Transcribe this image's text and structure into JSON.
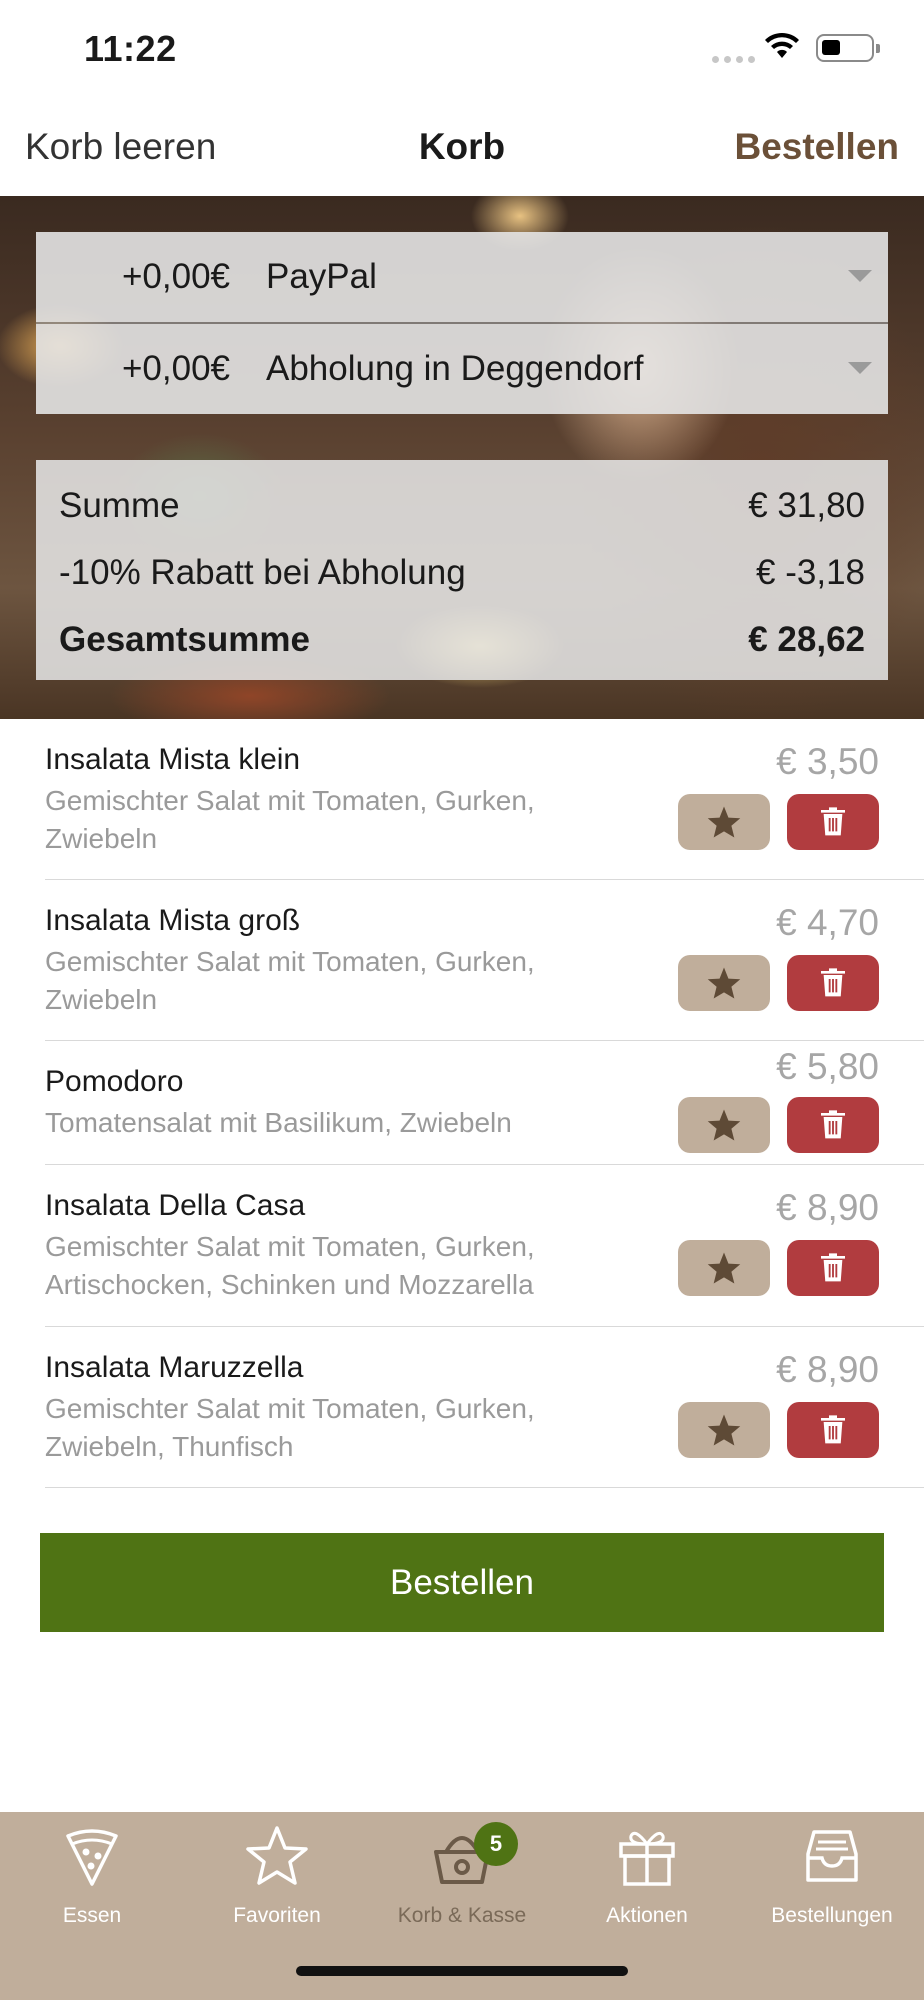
{
  "status": {
    "time": "11:22"
  },
  "nav": {
    "left": "Korb leeren",
    "title": "Korb",
    "right": "Bestellen"
  },
  "payment": {
    "price": "+0,00€",
    "label": "PayPal"
  },
  "delivery": {
    "price": "+0,00€",
    "label": "Abholung in Deggendorf"
  },
  "summary": {
    "subtotal_label": "Summe",
    "subtotal_value": "€ 31,80",
    "discount_label": "-10% Rabatt bei Abholung",
    "discount_value": "€ -3,18",
    "total_label": "Gesamtsumme",
    "total_value": "€ 28,62"
  },
  "items": [
    {
      "name": "Insalata Mista klein",
      "desc": "Gemischter Salat mit Tomaten, Gurken, Zwiebeln",
      "price": "€ 3,50"
    },
    {
      "name": "Insalata Mista groß",
      "desc": "Gemischter Salat mit Tomaten, Gurken, Zwiebeln",
      "price": "€ 4,70"
    },
    {
      "name": "Pomodoro",
      "desc": "Tomatensalat mit Basilikum, Zwiebeln",
      "price": "€ 5,80"
    },
    {
      "name": "Insalata Della Casa",
      "desc": "Gemischter Salat mit Tomaten, Gurken, Artischocken, Schinken und Mozzarella",
      "price": "€ 8,90"
    },
    {
      "name": "Insalata Maruzzella",
      "desc": "Gemischter Salat mit Tomaten, Gurken, Zwiebeln, Thunfisch",
      "price": "€ 8,90"
    }
  ],
  "order_button": "Bestellen",
  "tabs": [
    {
      "label": "Essen",
      "icon": "pizza-icon"
    },
    {
      "label": "Favoriten",
      "icon": "star-icon"
    },
    {
      "label": "Korb & Kasse",
      "icon": "basket-icon",
      "badge": "5"
    },
    {
      "label": "Aktionen",
      "icon": "gift-icon"
    },
    {
      "label": "Bestellungen",
      "icon": "tray-icon"
    }
  ],
  "colors": {
    "accent_green": "#4f7314",
    "delete_red": "#b13c3f",
    "favorite_beige": "#c0ae9b",
    "nav_brown": "#6b5038"
  }
}
